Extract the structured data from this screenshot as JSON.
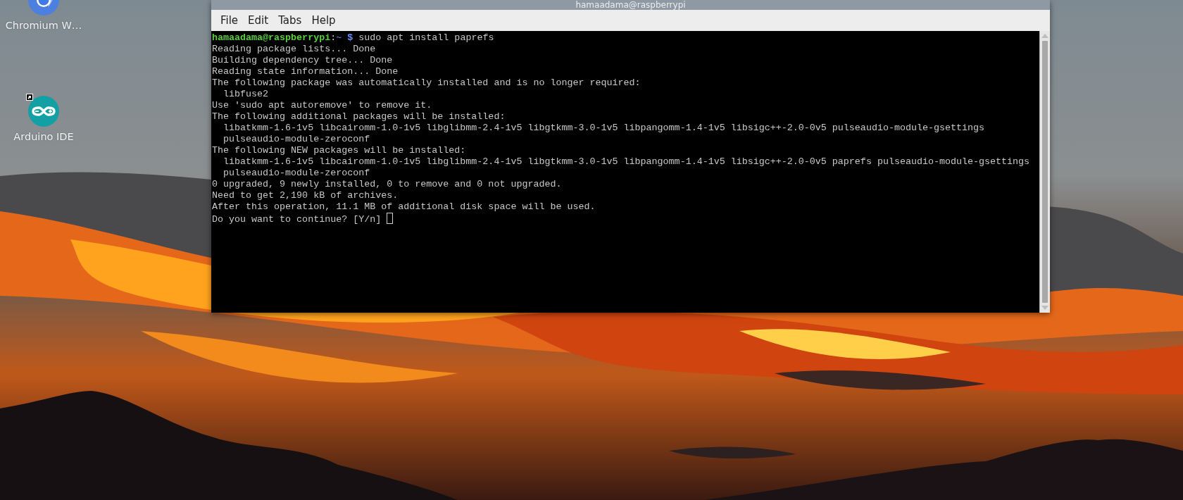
{
  "desktop": {
    "icons": [
      {
        "kind": "chromium",
        "label": "Chromium W…",
        "shortcut": false
      },
      {
        "kind": "arduino",
        "label": "Arduino IDE",
        "shortcut": true
      }
    ]
  },
  "window": {
    "title": "hamaadama@raspberrypi",
    "menu": [
      "File",
      "Edit",
      "Tabs",
      "Help"
    ],
    "terminal": {
      "lines": [
        {
          "kind": "prompt",
          "user_host": "hamaadama@raspberrypi",
          "separator": ":",
          "path": "~",
          "symbol": "$",
          "command": "sudo apt install paprefs"
        },
        {
          "kind": "output",
          "text": "Reading package lists... Done"
        },
        {
          "kind": "output",
          "text": "Building dependency tree... Done"
        },
        {
          "kind": "output",
          "text": "Reading state information... Done"
        },
        {
          "kind": "output",
          "text": "The following package was automatically installed and is no longer required:"
        },
        {
          "kind": "output",
          "text": "  libfuse2"
        },
        {
          "kind": "output",
          "text": "Use 'sudo apt autoremove' to remove it."
        },
        {
          "kind": "output",
          "text": "The following additional packages will be installed:"
        },
        {
          "kind": "output",
          "text": "  libatkmm-1.6-1v5 libcairomm-1.0-1v5 libglibmm-2.4-1v5 libgtkmm-3.0-1v5 libpangomm-1.4-1v5 libsigc++-2.0-0v5 pulseaudio-module-gsettings"
        },
        {
          "kind": "output",
          "text": "  pulseaudio-module-zeroconf"
        },
        {
          "kind": "output",
          "text": "The following NEW packages will be installed:"
        },
        {
          "kind": "output",
          "text": "  libatkmm-1.6-1v5 libcairomm-1.0-1v5 libglibmm-2.4-1v5 libgtkmm-3.0-1v5 libpangomm-1.4-1v5 libsigc++-2.0-0v5 paprefs pulseaudio-module-gsettings"
        },
        {
          "kind": "output",
          "text": "  pulseaudio-module-zeroconf"
        },
        {
          "kind": "output",
          "text": "0 upgraded, 9 newly installed, 0 to remove and 0 not upgraded."
        },
        {
          "kind": "output",
          "text": "Need to get 2,190 kB of archives."
        },
        {
          "kind": "output",
          "text": "After this operation, 11.1 MB of additional disk space will be used."
        },
        {
          "kind": "input",
          "text": "Do you want to continue? [Y/n] ",
          "cursor": true
        }
      ]
    }
  }
}
